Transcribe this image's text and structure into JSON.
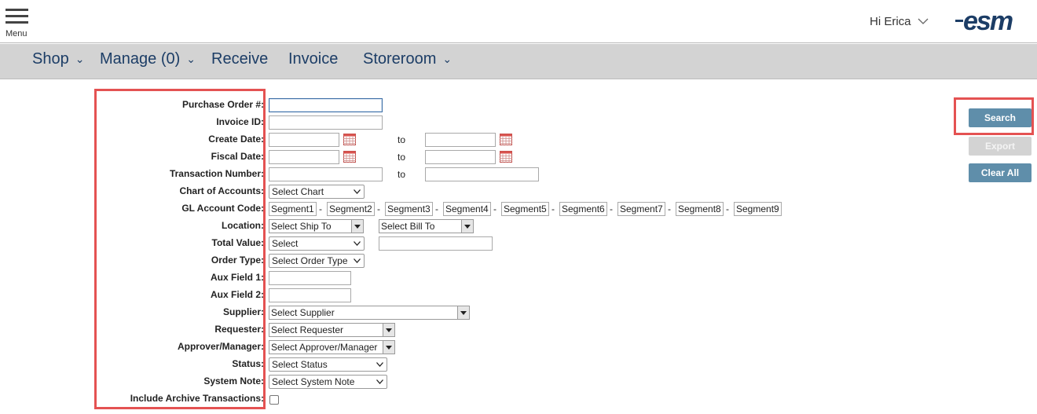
{
  "header": {
    "menu_label": "Menu",
    "greeting": "Hi Erica",
    "logo_text": "esm"
  },
  "nav": {
    "items": [
      {
        "label": "Shop",
        "has_dropdown": true
      },
      {
        "label": "Manage (0)",
        "has_dropdown": true
      },
      {
        "label": "Receive",
        "has_dropdown": false
      },
      {
        "label": "Invoice",
        "has_dropdown": false
      },
      {
        "label": "Storeroom",
        "has_dropdown": true
      }
    ]
  },
  "form": {
    "labels": {
      "purchase_order": "Purchase Order #:",
      "invoice_id": "Invoice ID:",
      "create_date": "Create Date:",
      "fiscal_date": "Fiscal Date:",
      "transaction_number": "Transaction Number:",
      "chart_of_accounts": "Chart of Accounts:",
      "gl_account_code": "GL Account Code:",
      "location": "Location:",
      "total_value": "Total Value:",
      "order_type": "Order Type:",
      "aux_field_1": "Aux Field 1:",
      "aux_field_2": "Aux Field 2:",
      "supplier": "Supplier:",
      "requester": "Requester:",
      "approver_manager": "Approver/Manager:",
      "status": "Status:",
      "system_note": "System Note:",
      "include_archive": "Include Archive Transactions:"
    },
    "to_label": "to",
    "values": {
      "purchase_order": "",
      "invoice_id": "",
      "create_date_from": "",
      "create_date_to": "",
      "fiscal_date_from": "",
      "fiscal_date_to": "",
      "transaction_number_from": "",
      "transaction_number_to": "",
      "total_value_amount": "",
      "aux_field_1": "",
      "aux_field_2": "",
      "include_archive": false
    },
    "selects": {
      "chart": "Select Chart",
      "ship_to": "Select Ship To",
      "bill_to": "Select Bill To",
      "total_value": "Select",
      "order_type": "Select Order Type",
      "supplier": "Select Supplier",
      "requester": "Select Requester",
      "approver": "Select Approver/Manager",
      "status": "Select Status",
      "system_note": "Select System Note"
    },
    "segments": [
      "Segment1",
      "Segment2",
      "Segment3",
      "Segment4",
      "Segment5",
      "Segment6",
      "Segment7",
      "Segment8",
      "Segment9"
    ],
    "segment_separator": "-"
  },
  "actions": {
    "search": "Search",
    "export": "Export",
    "clear_all": "Clear All"
  },
  "colors": {
    "brand_navy": "#1c3d66",
    "nav_bg": "#d3d3d3",
    "button_primary": "#5f8eaa",
    "button_disabled": "#d3d3d3",
    "highlight_red": "#e45252"
  }
}
